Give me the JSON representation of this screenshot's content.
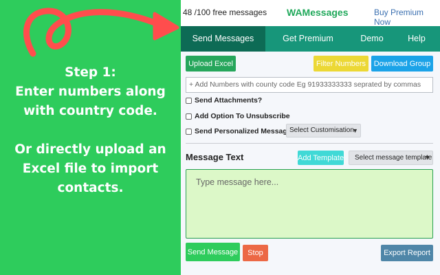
{
  "promo": {
    "line1": "Step 1:",
    "line2": "Enter numbers along",
    "line3": "with country code.",
    "line4": "Or directly upload an",
    "line5": "Excel file to import",
    "line6": "contacts."
  },
  "header": {
    "message_count": "48 /100 free messages",
    "brand": "WAMessages",
    "buy_premium": "Buy Premium Now"
  },
  "tabs": [
    {
      "label": "Send Messages",
      "active": true
    },
    {
      "label": "Get Premium",
      "active": false
    },
    {
      "label": "Demo",
      "active": false
    },
    {
      "label": "Help",
      "active": false
    }
  ],
  "toolbar": {
    "upload_excel": "Upload Excel",
    "filter_numbers": "Filter Numbers",
    "download_group": "Download Group"
  },
  "numbers_input": {
    "placeholder": "+ Add Numbers with county code Eg 91933333333 seprated by commas",
    "value": ""
  },
  "options": {
    "send_attachments": "Send Attachments?",
    "add_unsubscribe": "Add Option To Unsubscribe",
    "send_personalized": "Send Personalized Message",
    "customisation_select": "Select Customisation"
  },
  "message": {
    "label": "Message Text",
    "add_template": "Add Template",
    "template_select": "Select message template",
    "placeholder": "Type message here..."
  },
  "actions": {
    "send_message": "Send Message",
    "stop": "Stop",
    "export_report": "Export Report"
  },
  "colors": {
    "promo_green": "#2ecc5c",
    "brand_green": "#1fa85a",
    "tab_bar": "#17967a",
    "tab_active": "#0d6b55",
    "message_box": "#dcf8c8"
  },
  "icons": {
    "arrow": "curly-arrow-icon",
    "dropdown": "chevron-down-icon"
  }
}
